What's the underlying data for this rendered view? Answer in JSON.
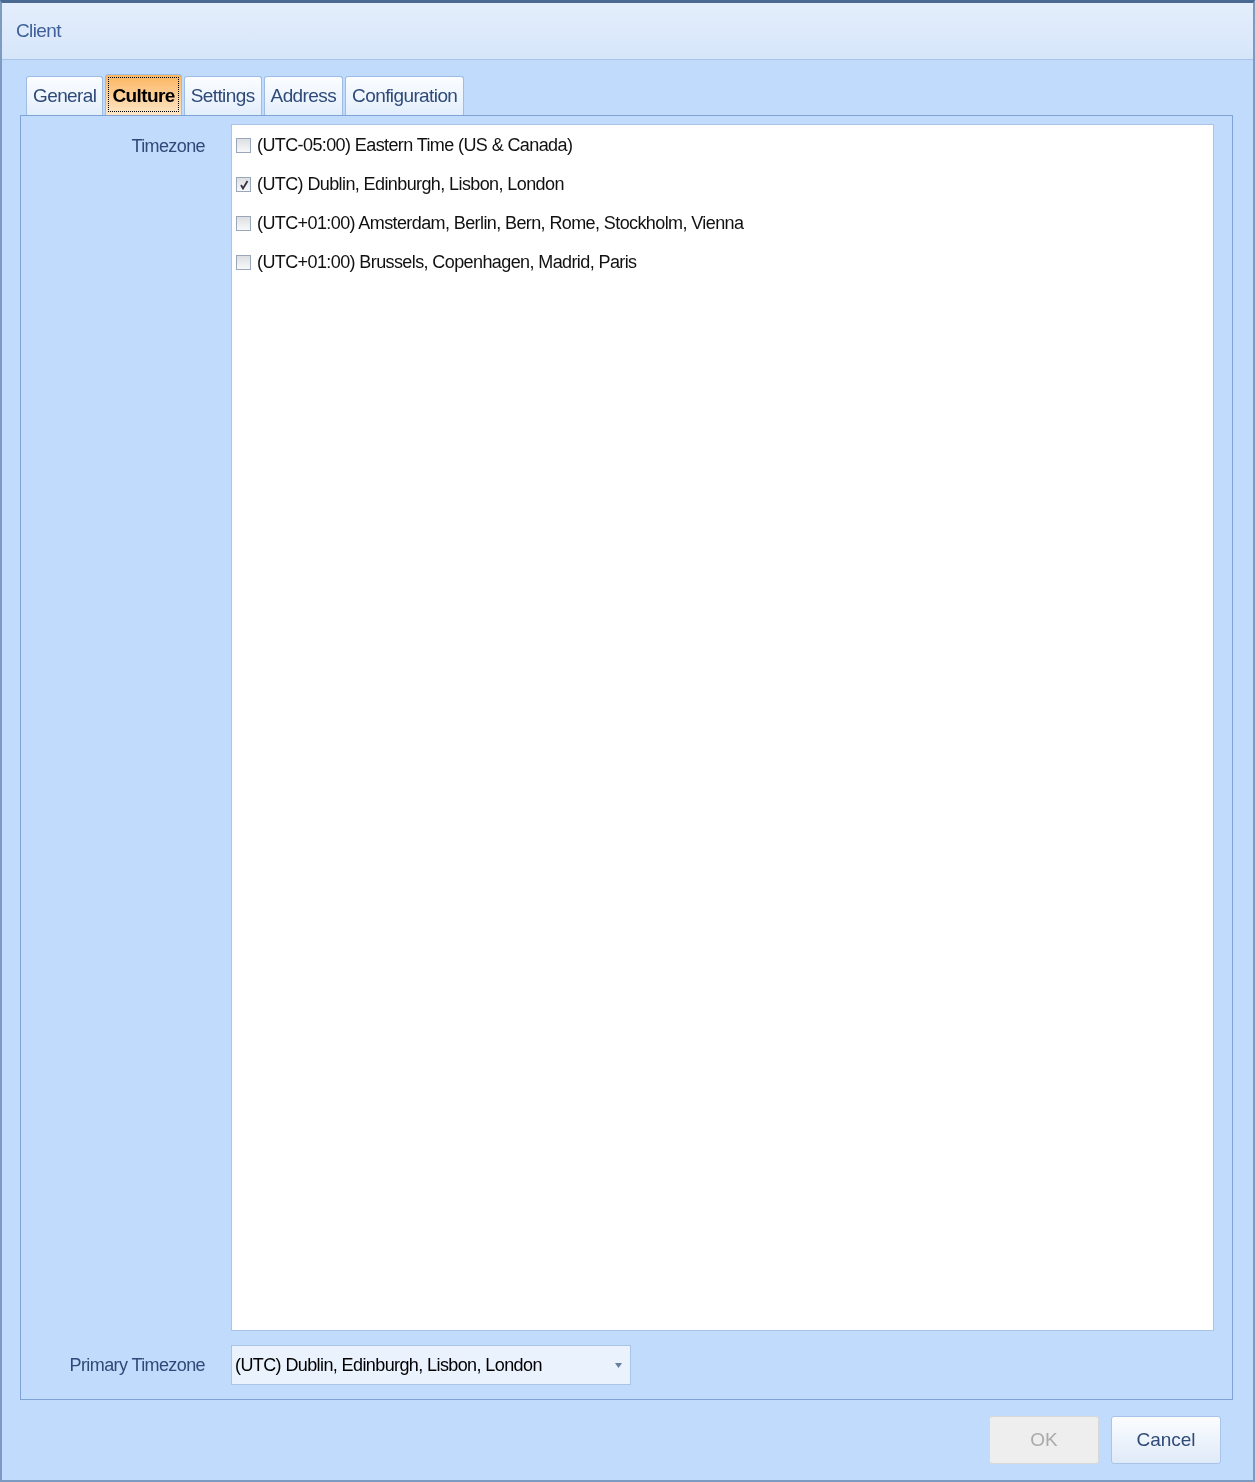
{
  "window": {
    "title": "Client"
  },
  "tabs": [
    {
      "label": "General",
      "selected": false
    },
    {
      "label": "Culture",
      "selected": true
    },
    {
      "label": "Settings",
      "selected": false
    },
    {
      "label": "Address",
      "selected": false
    },
    {
      "label": "Configuration",
      "selected": false
    }
  ],
  "timezone": {
    "label": "Timezone",
    "items": [
      {
        "label": "(UTC-05:00) Eastern Time (US & Canada)",
        "checked": false
      },
      {
        "label": "(UTC) Dublin, Edinburgh, Lisbon, London",
        "checked": true
      },
      {
        "label": "(UTC+01:00) Amsterdam, Berlin, Bern, Rome, Stockholm, Vienna",
        "checked": false
      },
      {
        "label": "(UTC+01:00) Brussels, Copenhagen, Madrid, Paris",
        "checked": false
      }
    ]
  },
  "primary_timezone": {
    "label": "Primary Timezone",
    "value": "(UTC) Dublin, Edinburgh, Lisbon, London"
  },
  "buttons": [
    {
      "label": "OK",
      "disabled": true
    },
    {
      "label": "Cancel",
      "disabled": false
    }
  ]
}
